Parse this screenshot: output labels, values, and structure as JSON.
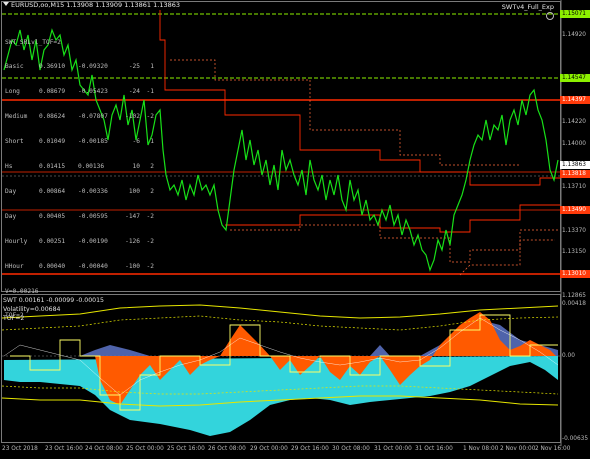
{
  "symbol": "EURUSD,oo,M15  1.13908 1.13909 1.13861 1.13863",
  "ea_name": "SWTv4_Full_Exp",
  "swt_panel": {
    "title": "SWT_SRLvl_TOF=2",
    "rows": [
      {
        "name": "Basic",
        "v1": "0.36910",
        "v2": "-0.09320",
        "v3": "-25",
        "v4": "1"
      },
      {
        "name": "Long",
        "v1": "0.08679",
        "v2": "-0.05423",
        "v3": "-24",
        "v4": "-1"
      },
      {
        "name": "Medium",
        "v1": "0.08624",
        "v2": "-0.07807",
        "v3": "-102",
        "v4": "-2"
      },
      {
        "name": "Short",
        "v1": "0.01049",
        "v2": "-0.00185",
        "v3": "-6",
        "v4": "1"
      },
      {
        "name": "Hs",
        "v1": "0.01415",
        "v2": "0.00136",
        "v3": "10",
        "v4": "2"
      },
      {
        "name": "Day",
        "v1": "0.00864",
        "v2": "-0.00336",
        "v3": "100",
        "v4": "2"
      },
      {
        "name": "Day",
        "v1": "0.00405",
        "v2": "-0.00595",
        "v3": "-147",
        "v4": "-2"
      },
      {
        "name": "Hourly",
        "v1": "0.00251",
        "v2": "-0.00190",
        "v3": "-126",
        "v4": "-2"
      },
      {
        "name": "HHour",
        "v1": "0.00040",
        "v2": "-0.00040",
        "v3": "-100",
        "v4": "-2"
      }
    ],
    "v_line": "V=0.00216",
    "tof_line": "TOF=2"
  },
  "indicator": {
    "header": "SWT 0.00161 -0.00099 -0.00015",
    "volatility": "Volatility=0.00684",
    "tof": "TOF=2"
  },
  "price_tags": [
    {
      "price": "1.15071",
      "style": "green"
    },
    {
      "price": "1.14920",
      "style": "plain"
    },
    {
      "price": "1.14547",
      "style": "green"
    },
    {
      "price": "1.14397",
      "style": "red"
    },
    {
      "price": "1.14220",
      "style": "plain"
    },
    {
      "price": "1.14000",
      "style": "plain"
    },
    {
      "price": "1.13863",
      "style": "white"
    },
    {
      "price": "1.13818",
      "style": "red"
    },
    {
      "price": "1.13710",
      "style": "plain"
    },
    {
      "price": "1.13490",
      "style": "red"
    },
    {
      "price": "1.13370",
      "style": "plain"
    },
    {
      "price": "1.13150",
      "style": "plain"
    },
    {
      "price": "1.13010",
      "style": "red"
    },
    {
      "price": "1.12865",
      "style": "plain"
    }
  ],
  "indicator_scale": [
    "0.00418",
    "0.00",
    "-0.00635"
  ],
  "date_labels": [
    "23 Oct 2018",
    "23 Oct 16:00",
    "24 Oct 08:00",
    "25 Oct 00:00",
    "25 Oct 16:00",
    "26 Oct 08:00",
    "29 Oct 00:00",
    "29 Oct 16:00",
    "30 Oct 08:00",
    "31 Oct 00:00",
    "31 Oct 16:00",
    "1 Nov 08:00",
    "2 Nov 00:00",
    "2 Nov 16:00"
  ],
  "colors": {
    "price_line": "#18e018",
    "support_resistance": "#ff2a00",
    "dashed_level": "#ff6a3a",
    "green_level": "#8cf000",
    "band_yellow": "#e6e600",
    "fill_orange": "#ff5a00",
    "fill_cyan": "#33d4dc",
    "fill_blue": "#5d74c8"
  }
}
